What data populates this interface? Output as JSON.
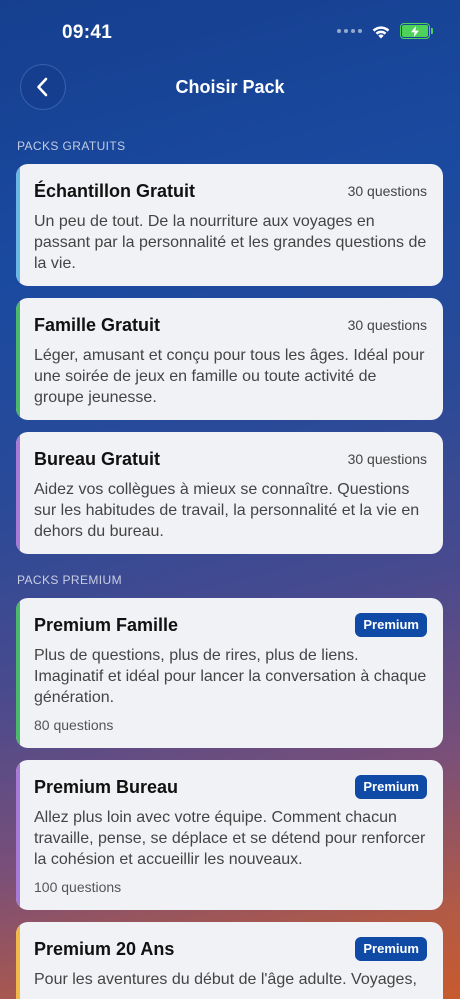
{
  "status": {
    "time": "09:41"
  },
  "nav": {
    "title": "Choisir Pack"
  },
  "sections": {
    "free": "PACKS GRATUITS",
    "premium": "PACKS PREMIUM"
  },
  "free_packs": [
    {
      "title": "Échantillon Gratuit",
      "count": "30 questions",
      "description": "Un peu de tout. De la nourriture aux voyages en passant par la personnalité et les grandes questions de la vie.",
      "accent": "#6bb6e3"
    },
    {
      "title": "Famille Gratuit",
      "count": "30 questions",
      "description": "Léger, amusant et conçu pour tous les âges. Idéal pour une soirée de jeux en famille ou toute activité de groupe jeunesse.",
      "accent": "#4cb86a"
    },
    {
      "title": "Bureau Gratuit",
      "count": "30 questions",
      "description": "Aidez vos collègues à mieux se connaître. Questions sur les habitudes de travail, la personnalité et la vie en dehors du bureau.",
      "accent": "#a77ad6"
    }
  ],
  "premium_packs": [
    {
      "title": "Premium Famille",
      "badge": "Premium",
      "description": "Plus de questions, plus de rires, plus de liens. Imaginatif et idéal pour lancer la conversation à chaque génération.",
      "count": "80 questions",
      "accent": "#4cb86a"
    },
    {
      "title": "Premium Bureau",
      "badge": "Premium",
      "description": "Allez plus loin avec votre équipe. Comment chacun travaille, pense, se déplace et se détend pour renforcer la cohésion et accueillir les nouveaux.",
      "count": "100 questions",
      "accent": "#a77ad6"
    },
    {
      "title": "Premium 20 Ans",
      "badge": "Premium",
      "description": "Pour les aventures du début de l'âge adulte. Voyages,",
      "count": "",
      "accent": "#f0b94a"
    }
  ],
  "colors": {
    "badge": "#0f4aa6",
    "card_bg": "#f1f2f6"
  }
}
